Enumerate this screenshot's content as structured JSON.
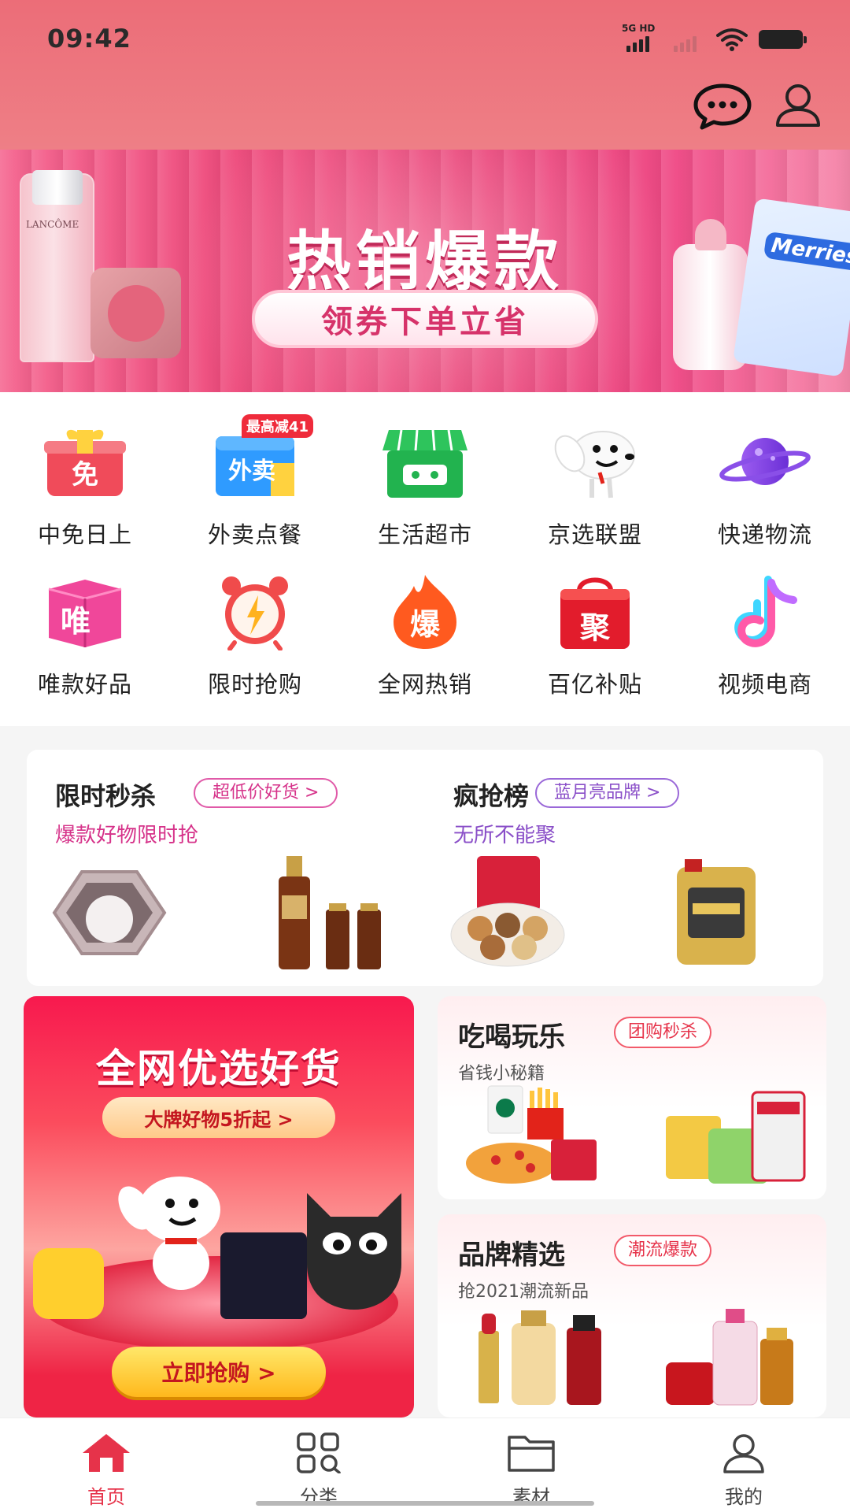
{
  "status_bar": {
    "time": "09:42",
    "network": "5G HD"
  },
  "banner": {
    "title": "热销爆款",
    "pill": "领券下单立省",
    "bottle_brand": "LANCÔME",
    "diaper_brand": "Merries"
  },
  "categories": [
    {
      "label": "中免日上",
      "icon": "gift-icon",
      "glyph": "免"
    },
    {
      "label": "外卖点餐",
      "icon": "takeout-icon",
      "glyph": "外卖",
      "badge": "最高减41"
    },
    {
      "label": "生活超市",
      "icon": "store-icon"
    },
    {
      "label": "京选联盟",
      "icon": "dog-mascot-icon"
    },
    {
      "label": "快递物流",
      "icon": "planet-icon"
    },
    {
      "label": "唯款好品",
      "icon": "box-icon",
      "glyph": "唯"
    },
    {
      "label": "限时抢购",
      "icon": "alarm-clock-icon"
    },
    {
      "label": "全网热销",
      "icon": "fire-icon",
      "glyph": "爆"
    },
    {
      "label": "百亿补贴",
      "icon": "shopping-bag-icon",
      "glyph": "聚"
    },
    {
      "label": "视频电商",
      "icon": "tiktok-icon"
    }
  ],
  "promos": [
    {
      "title": "限时秒杀",
      "tag": "超低价好货 >",
      "subtitle": "爆款好物限时抢"
    },
    {
      "title": "疯抢榜",
      "tag": "蓝月亮品牌 >",
      "subtitle": "无所不能聚"
    }
  ],
  "big_banner": {
    "title": "全网优选好货",
    "pill": "大牌好物5折起 >",
    "cta": "立即抢购 >"
  },
  "cards": [
    {
      "title": "吃喝玩乐",
      "tag": "团购秒杀",
      "subtitle": "省钱小秘籍"
    },
    {
      "title": "品牌精选",
      "tag": "潮流爆款",
      "subtitle": "抢2021潮流新品"
    }
  ],
  "tabs": [
    {
      "label": "首页",
      "icon": "home-icon",
      "active": true
    },
    {
      "label": "分类",
      "icon": "category-grid-icon",
      "active": false
    },
    {
      "label": "素材",
      "icon": "folder-icon",
      "active": false
    },
    {
      "label": "我的",
      "icon": "person-icon",
      "active": false
    }
  ],
  "colors": {
    "accent": "#e6334a",
    "header": "#ec6d78",
    "purple": "#8a4fc8",
    "pink_text": "#d6338a"
  }
}
